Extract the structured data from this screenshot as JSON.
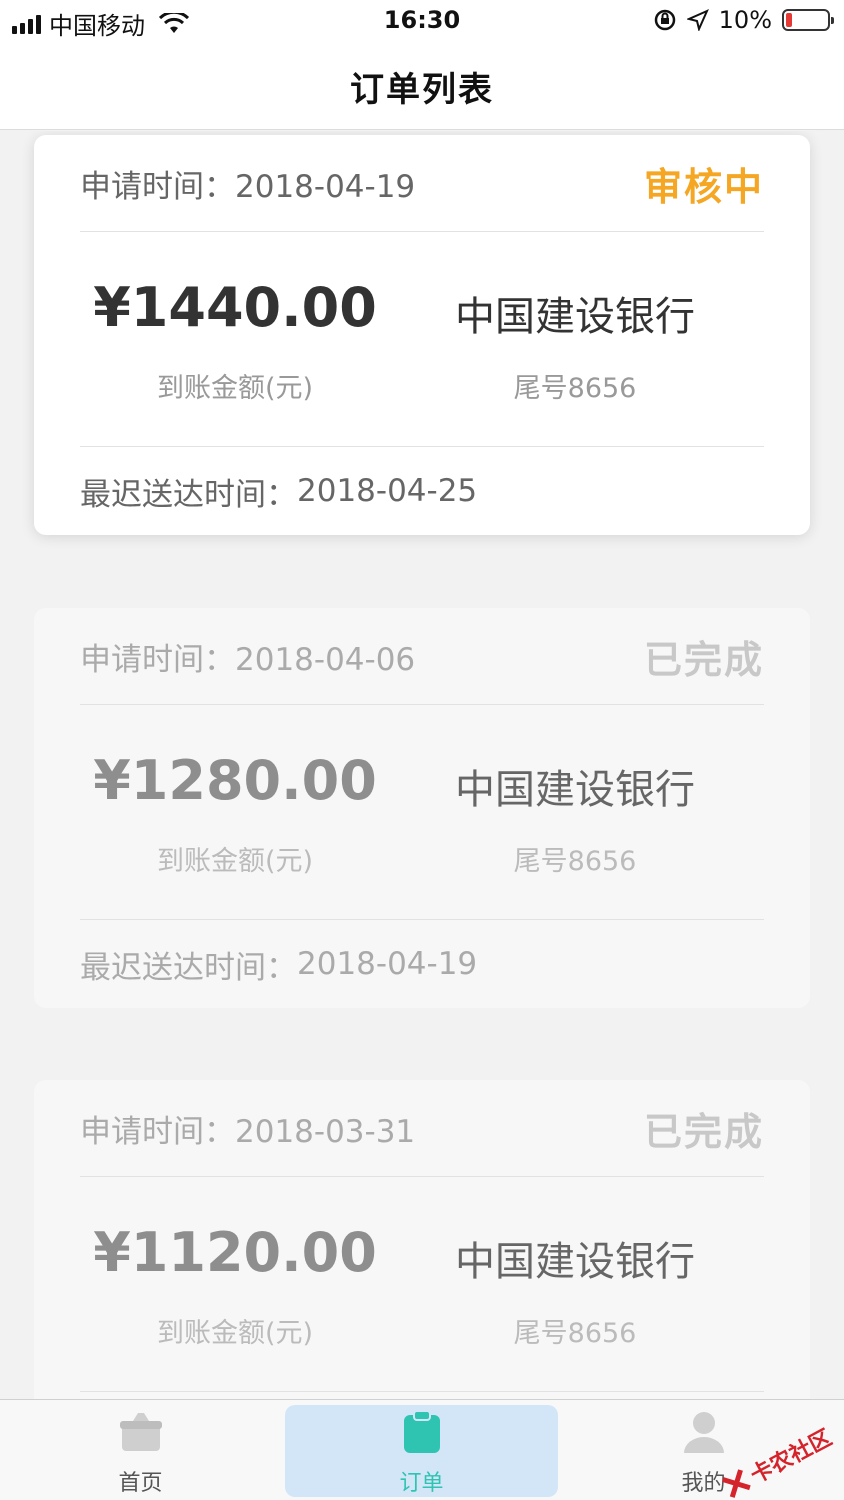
{
  "status_bar": {
    "carrier": "中国移动",
    "time": "16:30",
    "battery": "10%"
  },
  "header": {
    "title": "订单列表"
  },
  "orders": [
    {
      "apply_label": "申请时间：",
      "apply_date": "2018-04-19",
      "status": "审核中",
      "amount": "¥1440.00",
      "amount_label": "到账金额(元)",
      "bank": "中国建设银行",
      "tail": "尾号8656",
      "deadline_label": "最迟送达时间：",
      "deadline_date": "2018-04-25"
    },
    {
      "apply_label": "申请时间：",
      "apply_date": "2018-04-06",
      "status": "已完成",
      "amount": "¥1280.00",
      "amount_label": "到账金额(元)",
      "bank": "中国建设银行",
      "tail": "尾号8656",
      "deadline_label": "最迟送达时间：",
      "deadline_date": "2018-04-19"
    },
    {
      "apply_label": "申请时间：",
      "apply_date": "2018-03-31",
      "status": "已完成",
      "amount": "¥1120.00",
      "amount_label": "到账金额(元)",
      "bank": "中国建设银行",
      "tail": "尾号8656",
      "deadline_label": "",
      "deadline_date": ""
    }
  ],
  "tabbar": {
    "tabs": [
      {
        "label": "首页",
        "icon": "home-icon"
      },
      {
        "label": "订单",
        "icon": "clipboard-icon"
      },
      {
        "label": "我的",
        "icon": "user-icon"
      }
    ],
    "active_color": "#2fc4b2"
  },
  "watermark": "卡农社区",
  "colors": {
    "pending": "#f5a623",
    "done": "#c8c8c8",
    "battery_low": "#e53935"
  }
}
